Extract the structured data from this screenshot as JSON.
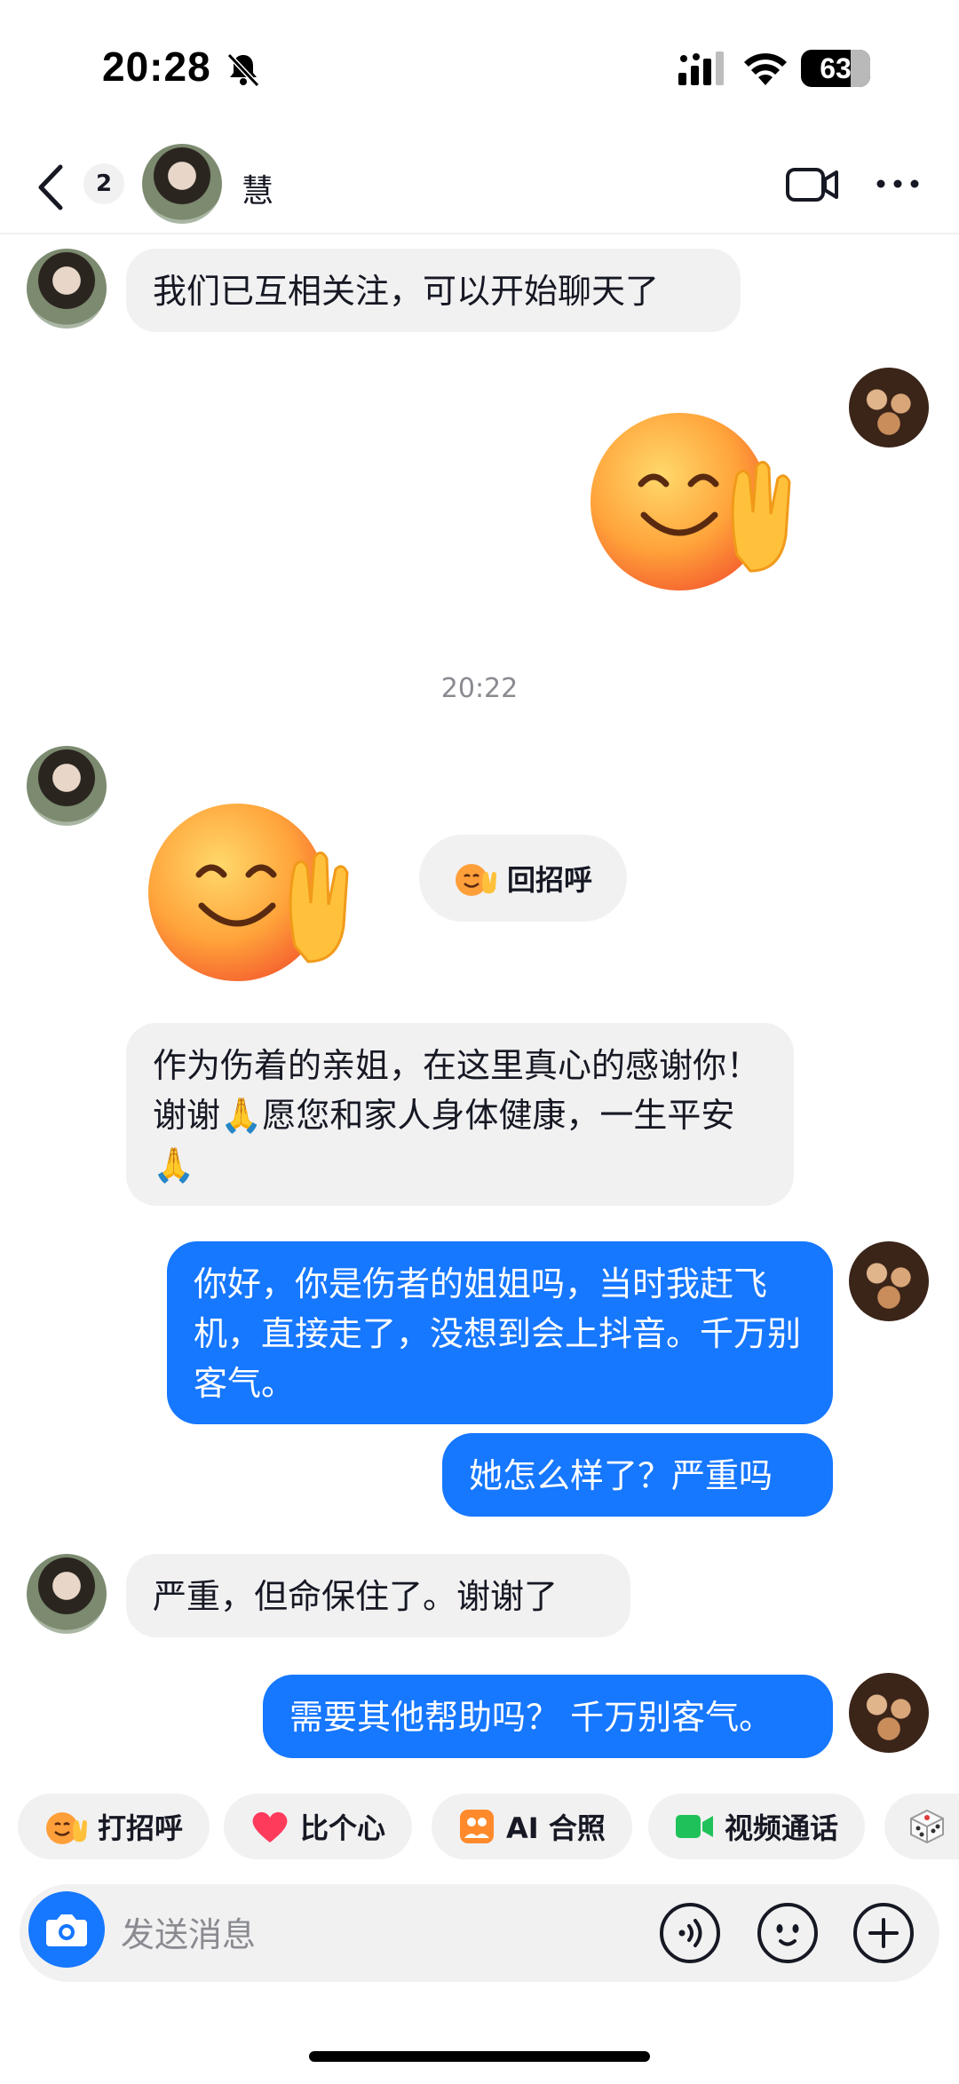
{
  "status_bar": {
    "time": "20:28",
    "battery": "63"
  },
  "header": {
    "back_badge": "2",
    "name": "慧"
  },
  "messages": [
    {
      "side": "in",
      "text": "我们已互相关注，可以开始聊天了"
    },
    {
      "side": "out",
      "type": "sticker",
      "sticker": "smile-wave-emoji"
    },
    {
      "type": "timestamp",
      "text": "20:22"
    },
    {
      "side": "in",
      "type": "sticker",
      "sticker": "smile-wave-emoji",
      "reply_chip": "回招呼"
    },
    {
      "side": "in",
      "text": "作为伤着的亲姐，在这里真心的感谢你！谢谢🙏愿您和家人身体健康，一生平安🙏"
    },
    {
      "side": "out",
      "text": "你好，你是伤者的姐姐吗，当时我赶飞机，直接走了，没想到会上抖音。千万别客气。"
    },
    {
      "side": "out",
      "text": "她怎么样了？严重吗"
    },
    {
      "side": "in",
      "text": "严重，但命保住了。谢谢了"
    },
    {
      "side": "out",
      "text": "需要其他帮助吗？ 千万别客气。"
    }
  ],
  "quick_actions": [
    {
      "label": "打招呼",
      "icon": "wave-emoji-icon"
    },
    {
      "label": "比个心",
      "icon": "heart-icon"
    },
    {
      "label": "AI 合照",
      "icon": "ai-photo-icon"
    },
    {
      "label": "视频通话",
      "icon": "video-call-icon"
    }
  ],
  "input": {
    "placeholder": "发送消息"
  },
  "colors": {
    "accent": "#1677ff",
    "bubble_in": "#f1f1f2"
  }
}
